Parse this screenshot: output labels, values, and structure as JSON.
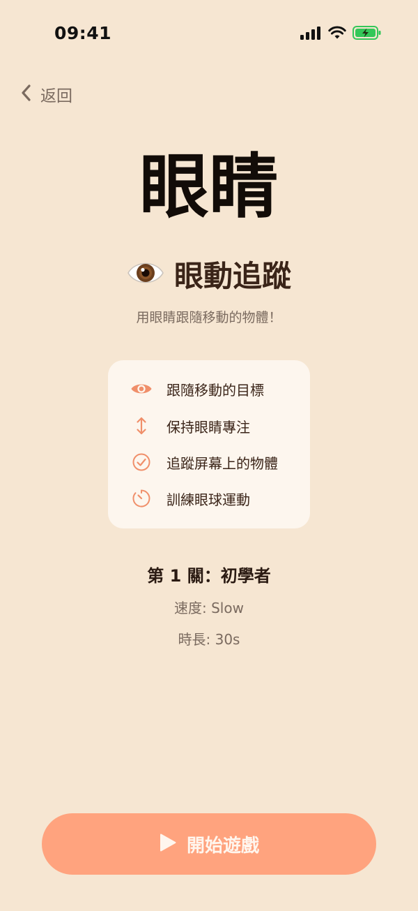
{
  "status_bar": {
    "time": "09:41"
  },
  "nav": {
    "back_label": "返回"
  },
  "header": {
    "main_title": "眼睛",
    "game_emoji": "👁️",
    "game_title": "眼動追蹤",
    "subtitle": "用眼睛跟隨移動的物體！"
  },
  "instructions": [
    {
      "icon": "eye-icon",
      "text": "跟隨移動的目標"
    },
    {
      "icon": "vertical-arrows-icon",
      "text": "保持眼睛專注"
    },
    {
      "icon": "check-circle-icon",
      "text": "追蹤屏幕上的物體"
    },
    {
      "icon": "timer-icon",
      "text": "訓練眼球運動"
    }
  ],
  "level": {
    "title": "第 1 關：初學者",
    "speed": "速度: Slow",
    "duration": "時長: 30s"
  },
  "start_button": {
    "label": "開始遊戲"
  },
  "colors": {
    "background": "#f6e6d2",
    "card": "#fdf6ee",
    "accent": "#ffa37e",
    "icon_accent": "#f08f6a",
    "battery_green": "#34c759"
  }
}
